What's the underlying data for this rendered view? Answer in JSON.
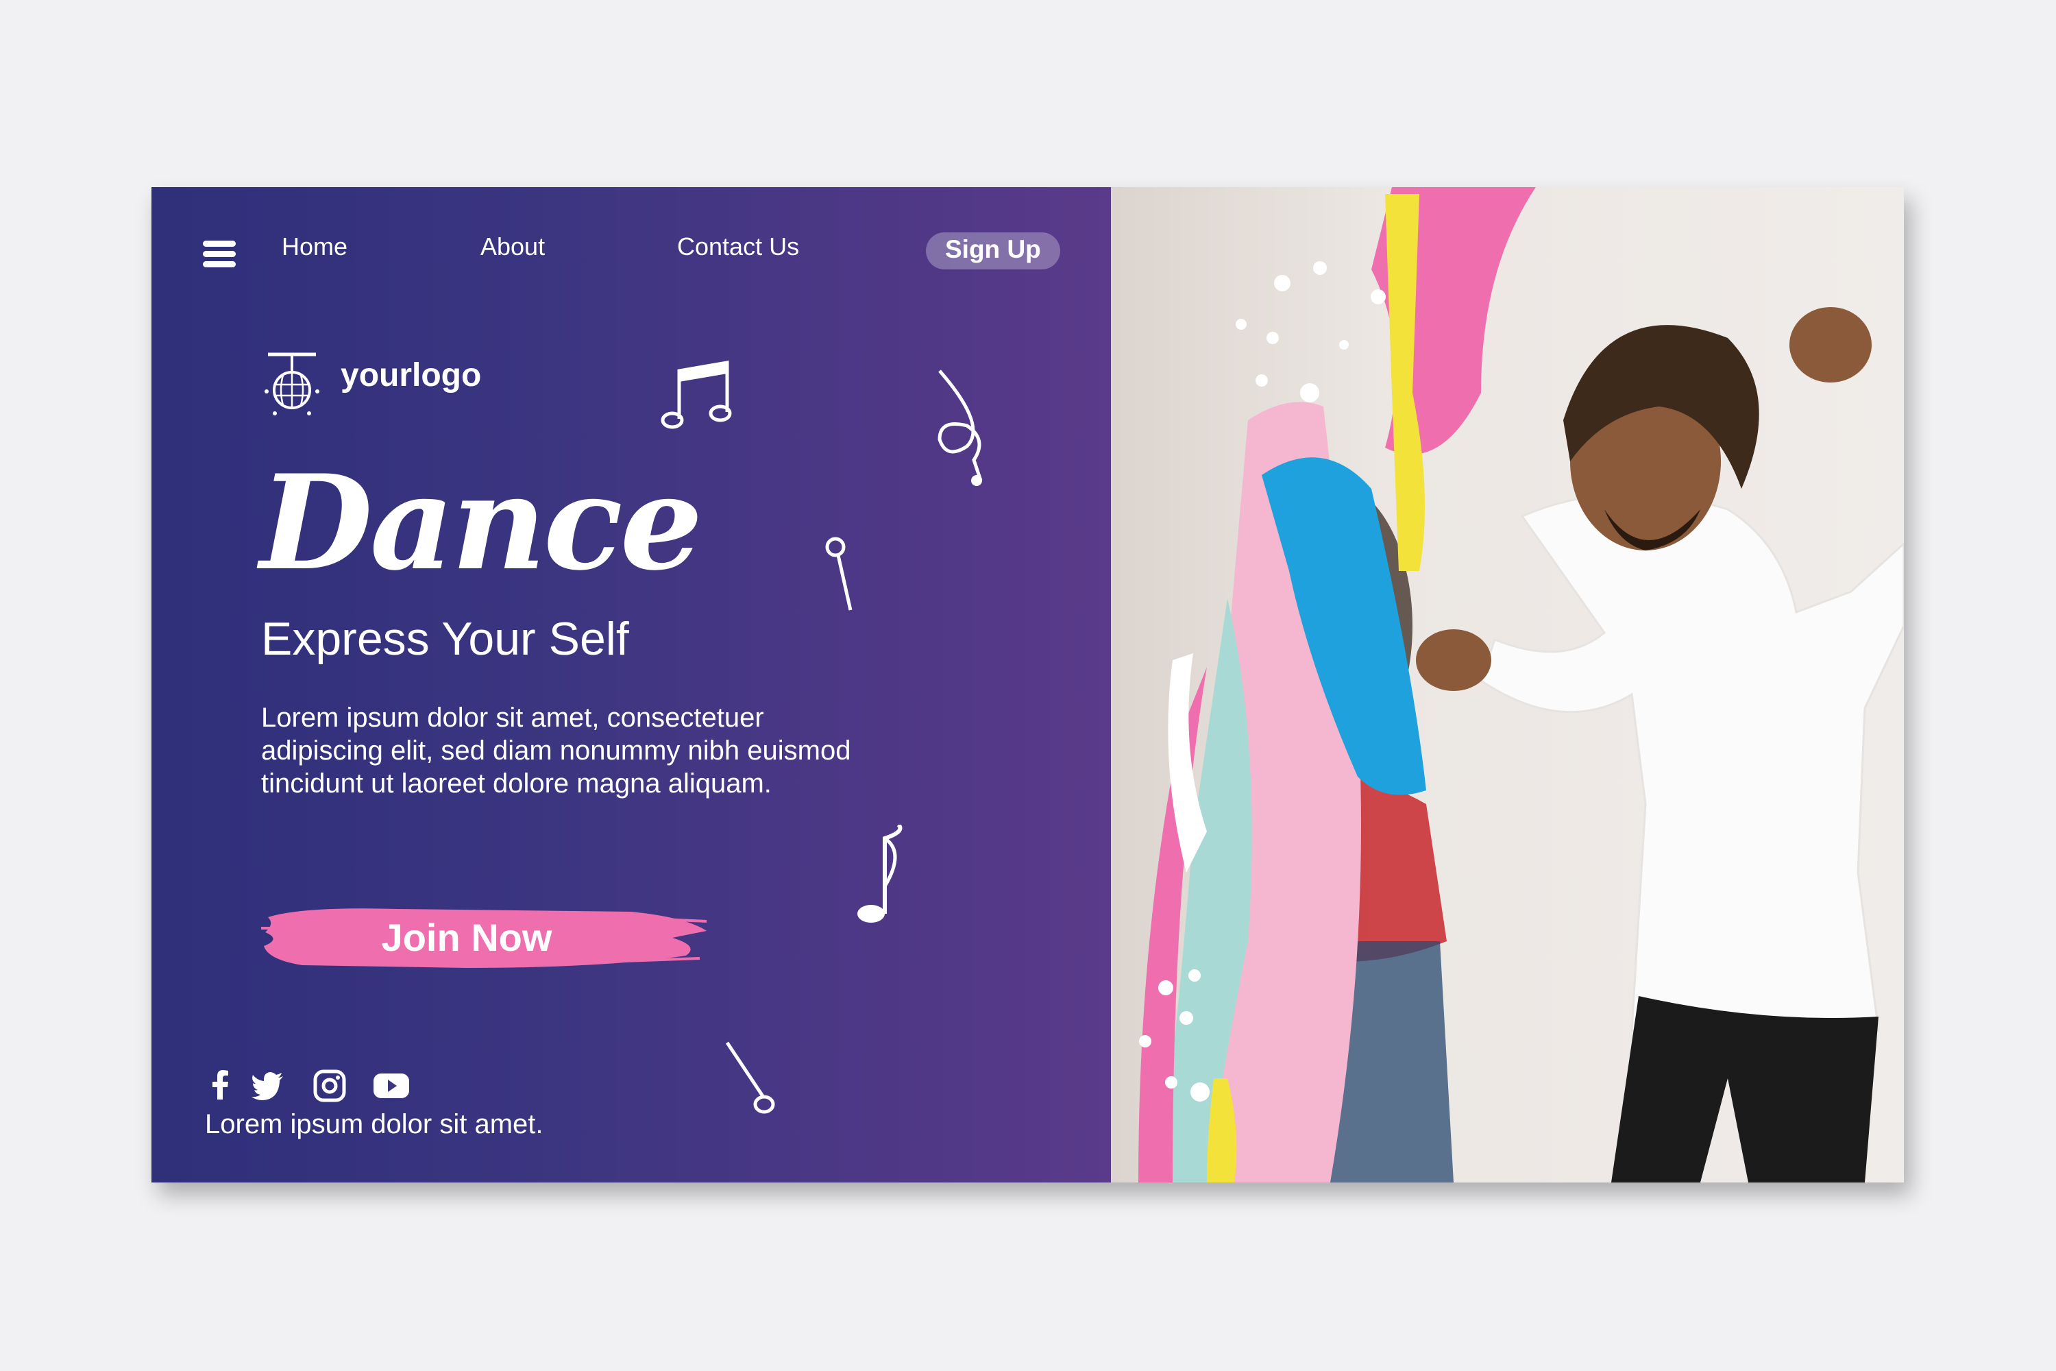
{
  "colors": {
    "background": "#f1f1f3",
    "panel_dark": "#2f2f7a",
    "panel_light": "#5a3a8a",
    "accent_pink": "#ef6fae",
    "text": "#ffffff"
  },
  "nav": {
    "menu_icon": "hamburger-icon",
    "items": [
      {
        "label": "Home"
      },
      {
        "label": "About"
      },
      {
        "label": "Contact Us"
      }
    ],
    "signup_label": "Sign Up"
  },
  "logo": {
    "icon": "disco-ball-icon",
    "text": "yourlogo"
  },
  "hero": {
    "title": "Dance",
    "subtitle": "Express Your Self",
    "body": "Lorem ipsum dolor sit amet, consectetuer adipiscing elit, sed diam nonummy nibh euismod tincidunt ut laoreet dolore magna aliquam.",
    "cta_label": "Join Now"
  },
  "social": {
    "icons": [
      "facebook-icon",
      "twitter-icon",
      "instagram-icon",
      "youtube-icon"
    ],
    "footer_text": "Lorem ipsum dolor sit amet."
  }
}
